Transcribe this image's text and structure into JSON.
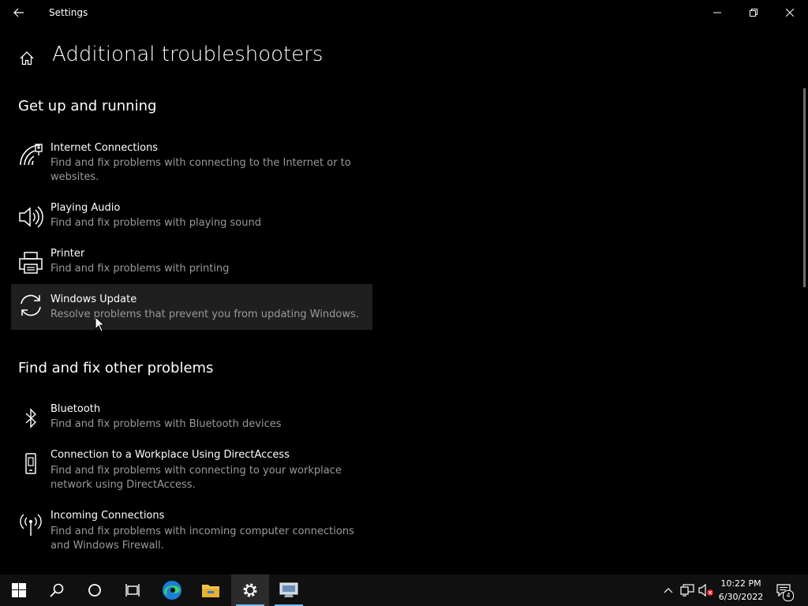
{
  "window": {
    "title": "Settings",
    "controls": {
      "minimize": "minimize-icon",
      "maximize": "restore-icon",
      "close": "close-icon"
    }
  },
  "page": {
    "title": "Additional troubleshooters"
  },
  "sections": [
    {
      "title": "Get up and running",
      "items": [
        {
          "icon": "network-icon",
          "title": "Internet Connections",
          "description": "Find and fix problems with connecting to the Internet or to websites."
        },
        {
          "icon": "speaker-icon",
          "title": "Playing Audio",
          "description": "Find and fix problems with playing sound"
        },
        {
          "icon": "printer-icon",
          "title": "Printer",
          "description": "Find and fix problems with printing"
        },
        {
          "icon": "sync-icon",
          "title": "Windows Update",
          "description": "Resolve problems that prevent you from updating Windows."
        }
      ]
    },
    {
      "title": "Find and fix other problems",
      "items": [
        {
          "icon": "bluetooth-icon",
          "title": "Bluetooth",
          "description": "Find and fix problems with Bluetooth devices"
        },
        {
          "icon": "phone-icon",
          "title": "Connection to a Workplace Using DirectAccess",
          "description": "Find and fix problems with connecting to your workplace network using DirectAccess."
        },
        {
          "icon": "antenna-icon",
          "title": "Incoming Connections",
          "description": "Find and fix problems with incoming computer connections and Windows Firewall."
        }
      ]
    }
  ],
  "taskbar": {
    "items": [
      "start-icon",
      "search-icon",
      "cortana-icon",
      "task-view-icon",
      "edge-icon",
      "file-explorer-icon",
      "settings-icon",
      "remote-desktop-icon"
    ],
    "active": "settings-icon",
    "tray": {
      "time": "10:22 PM",
      "date": "6/30/2022",
      "notification_count": "4"
    }
  },
  "colors": {
    "background": "#000000",
    "taskbar": "#101010",
    "hover_row": "#1f1f1f",
    "secondary_text": "#9a9a9a",
    "accent": "#76b9ed"
  }
}
